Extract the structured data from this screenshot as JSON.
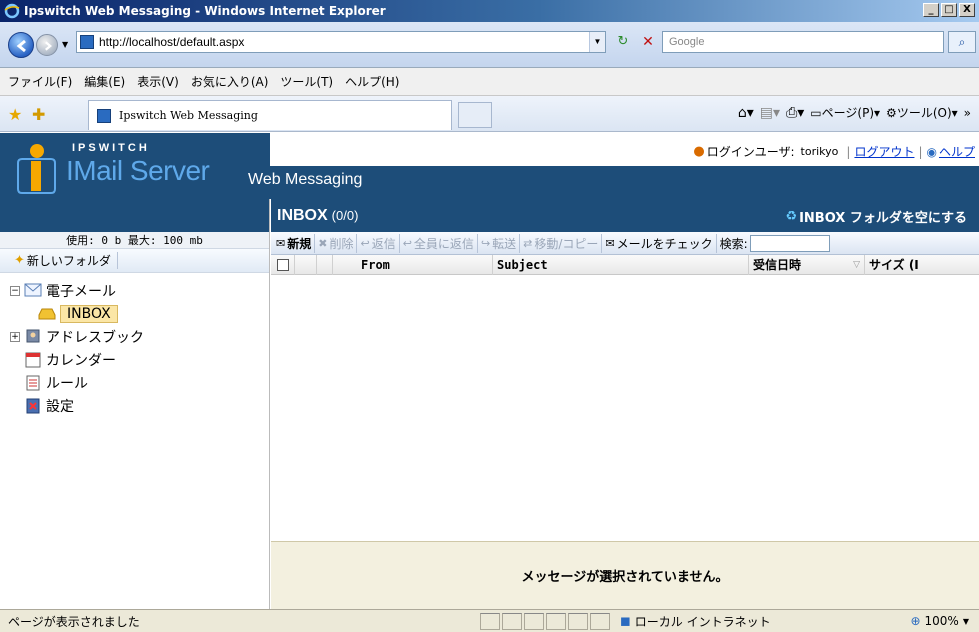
{
  "window": {
    "title": "Ipswitch Web Messaging - Windows Internet Explorer",
    "btn_min": "_",
    "btn_max": "□",
    "btn_close": "X"
  },
  "browser": {
    "url": "http://localhost/default.aspx",
    "search_placeholder": "Google",
    "tab_title": "Ipswitch Web Messaging",
    "menu": [
      "ファイル(F)",
      "編集(E)",
      "表示(V)",
      "お気に入り(A)",
      "ツール(T)",
      "ヘルプ(H)"
    ],
    "cmd_page": "ページ(P)",
    "cmd_tools": "ツール(O)",
    "cmd_more": "»"
  },
  "app": {
    "brand": "IPSWITCH",
    "product": "IMail Server",
    "subtitle": "Web Messaging",
    "user_label": "ログインユーザ:",
    "username": "torikyo",
    "logout": "ログアウト",
    "help": "ヘルプ",
    "sep": "|"
  },
  "sidebar": {
    "quota": "使用: 0 b 最大: 100 mb",
    "new_folder": "新しいフォルダ",
    "tree": {
      "mail": "電子メール",
      "inbox": "INBOX",
      "addressbook": "アドレスブック",
      "calendar": "カレンダー",
      "rules": "ルール",
      "settings": "設定"
    }
  },
  "mailbox": {
    "title": "INBOX",
    "count": "(0/0)",
    "empty_folder": "INBOX フォルダを空にする",
    "toolbar": {
      "new": "新規",
      "delete": "削除",
      "reply": "返信",
      "reply_all": "全員に返信",
      "forward": "転送",
      "move_copy": "移動/コピー",
      "check_mail": "メールをチェック",
      "search": "検索:"
    },
    "columns": {
      "from": "From",
      "subject": "Subject",
      "received": "受信日時",
      "size": "サイズ (I"
    },
    "preview_text": "メッセージが選択されていません。"
  },
  "statusbar": {
    "text": "ページが表示されました",
    "zone": "ローカル イントラネット",
    "zoom": "100%"
  },
  "colors": {
    "banner": "#1d4d79",
    "logo_accent": "#5fa9ea",
    "link": "#0033cc",
    "inbox_highlight": "#fbe6a6"
  }
}
